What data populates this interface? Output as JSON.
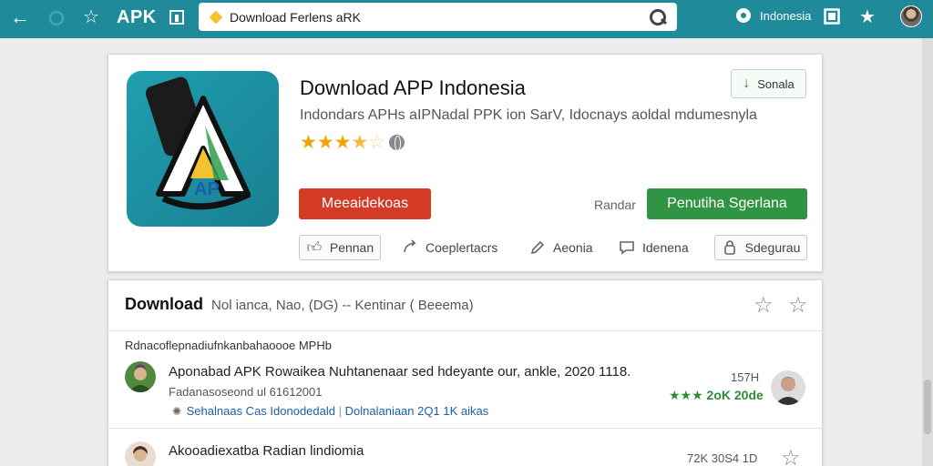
{
  "toolbar": {
    "apk_label": "APK",
    "url": "Download Ferlens aRK",
    "region": "Indonesia"
  },
  "app": {
    "title": "Download APP Indonesia",
    "subtitle": "Indondars APHs aIPNadal PPK ion SarV, Idocnays aoldal mdumesnyla",
    "rating_stars": 3.5,
    "icon_letters": "AP",
    "save_label": "Sonala",
    "primary_btn": "Meeaidekoas",
    "rank_label": "Randar",
    "green_btn": "Penutiha Sgerlana",
    "actions": [
      {
        "label": "Pennan",
        "icon": "thumb-up-icon"
      },
      {
        "label": "Coeplertacrs",
        "icon": "share-icon"
      },
      {
        "label": "Aeonia",
        "icon": "edit-icon"
      },
      {
        "label": "Idenena",
        "icon": "comment-icon"
      },
      {
        "label": "Sdegurau",
        "icon": "lock-icon"
      }
    ]
  },
  "list": {
    "heading": "Download",
    "heading_meta": "Nol ianca, Nao, (DG) -- Kentinar ( Beeema)",
    "subheading": "Rdnacoflepnadiufnkanbahaoooe MPHb",
    "items": [
      {
        "title": "Aponabad APK Rowaikea  Nuhtanenaar sed hdeyante our, ankle, 2020 1118.",
        "sub": "Fadanasoseond ul 61612001",
        "links": [
          "Sehalnaas Cas",
          "Idonodedald",
          "Dolnalaniaan",
          "2Q1 1K aikas"
        ],
        "size": "157H",
        "rating": "2oK 20de"
      },
      {
        "title": "Akooadiexatba Radian  lindiomia",
        "sub": "",
        "size": "72K 30S4 1D",
        "rating": ""
      }
    ]
  },
  "colors": {
    "topbar": "#1f8a9a",
    "accent_red": "#d33b26",
    "accent_green": "#2f9443",
    "star": "#f0a500",
    "link": "#1a5fa8"
  }
}
